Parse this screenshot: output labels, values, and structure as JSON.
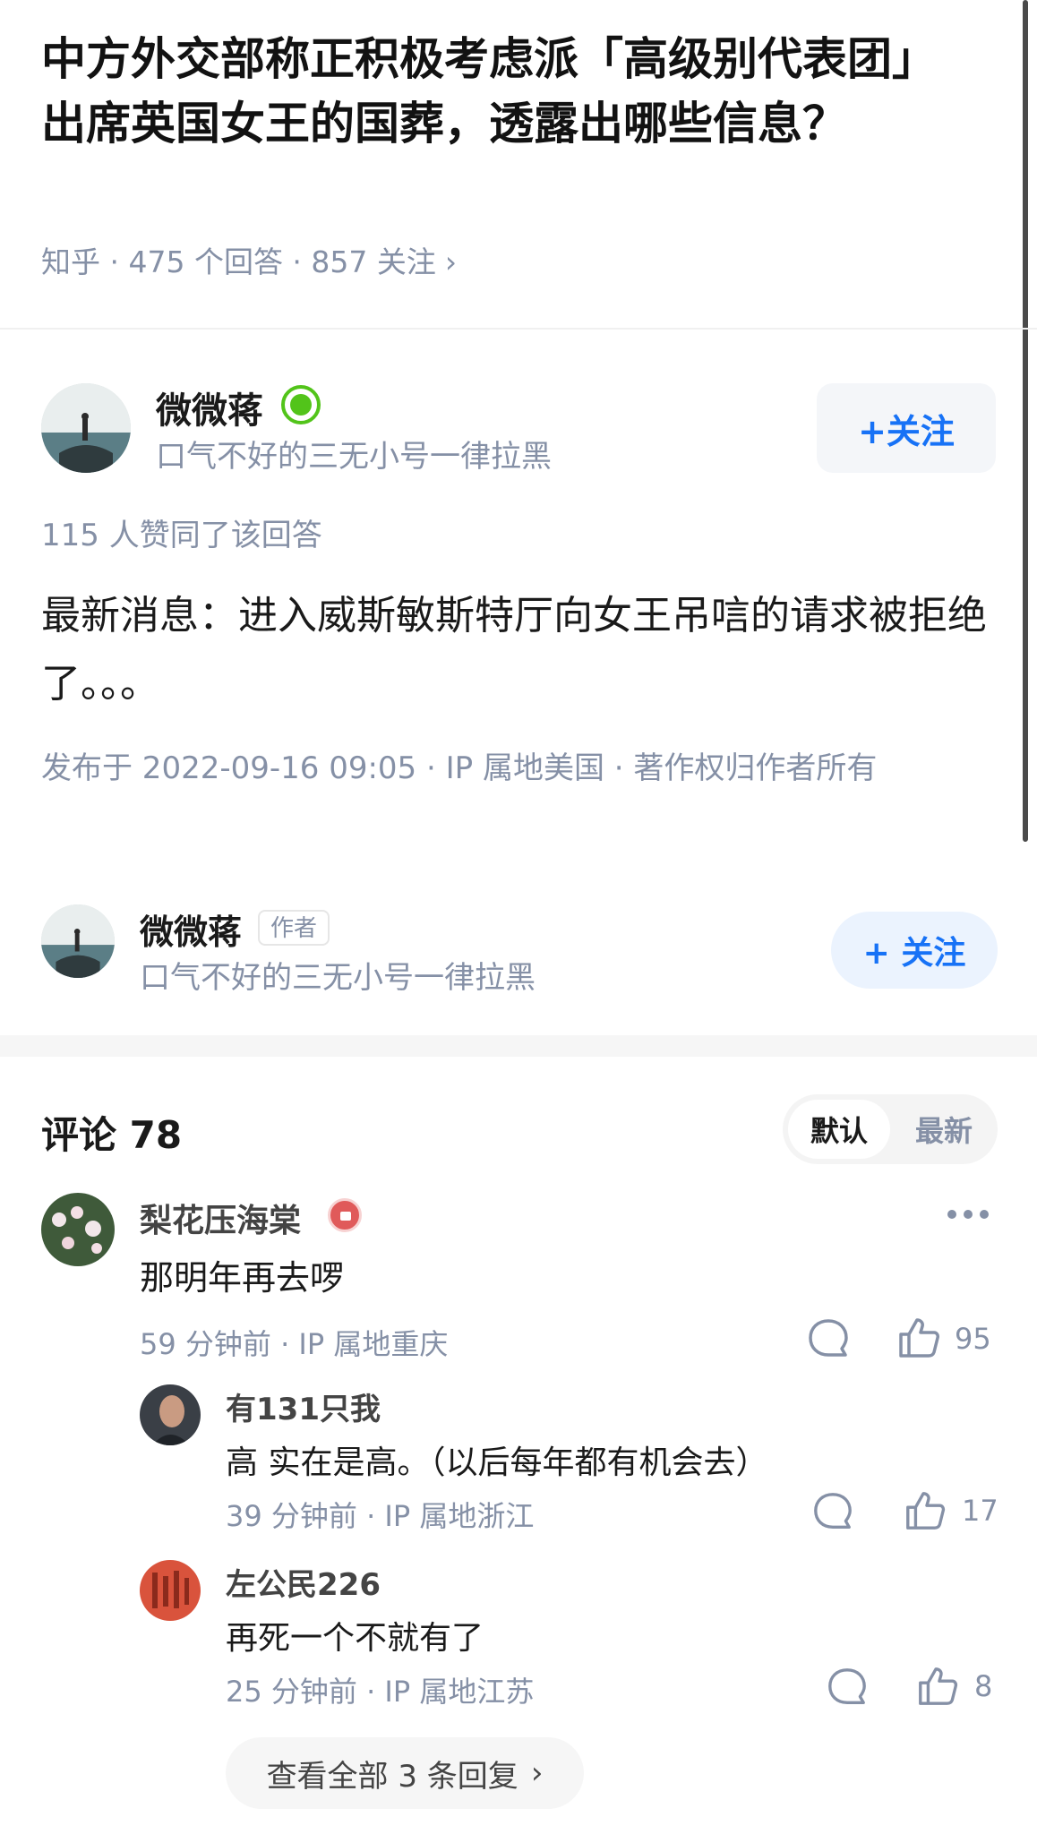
{
  "question": {
    "title": "中方外交部称正积极考虑派「高级别代表团」出席英国女王的国葬，透露出哪些信息？",
    "meta": "知乎 · 475 个回答 · 857 关注",
    "chevron": "›"
  },
  "answer": {
    "author_name": "微微蒋",
    "author_bio": "口气不好的三无小号一律拉黑",
    "follow_label": "+关注",
    "votes": "115 人赞同了该回答",
    "content": "最新消息：进入威斯敏斯特厅向女王吊唁的请求被拒绝了。。。",
    "publish_meta": "发布于 2022-09-16 09:05 · IP 属地美国 · 著作权归作者所有"
  },
  "author_card": {
    "name": "微微蒋",
    "tag": "作者",
    "bio": "口气不好的三无小号一律拉黑",
    "follow_label": "+ 关注"
  },
  "comments": {
    "title": "评论 78",
    "sort_default": "默认",
    "sort_latest": "最新",
    "items": [
      {
        "name": "梨花压海棠",
        "text": "那明年再去啰",
        "meta": "59 分钟前 · IP 属地重庆",
        "likes": "95"
      }
    ],
    "replies": [
      {
        "name": "有131只我",
        "text": "高 实在是高。（以后每年都有机会去）",
        "meta": "39 分钟前 · IP 属地浙江",
        "likes": "17"
      },
      {
        "name": "左公民226",
        "text": "再死一个不就有了",
        "meta": "25 分钟前 · IP 属地江苏",
        "likes": "8"
      }
    ],
    "view_all": "查看全部 3 条回复",
    "view_all_chevron": "›"
  },
  "colors": {
    "accent_blue": "#1772f6",
    "meta_gray": "#8590a6",
    "badge_green": "#52c41a",
    "badge_red": "#e05a5a"
  },
  "icons": [
    "trophy-badge-icon",
    "like-badge-icon",
    "comment-icon",
    "thumbs-up-icon",
    "more-icon",
    "chevron-right-icon"
  ]
}
